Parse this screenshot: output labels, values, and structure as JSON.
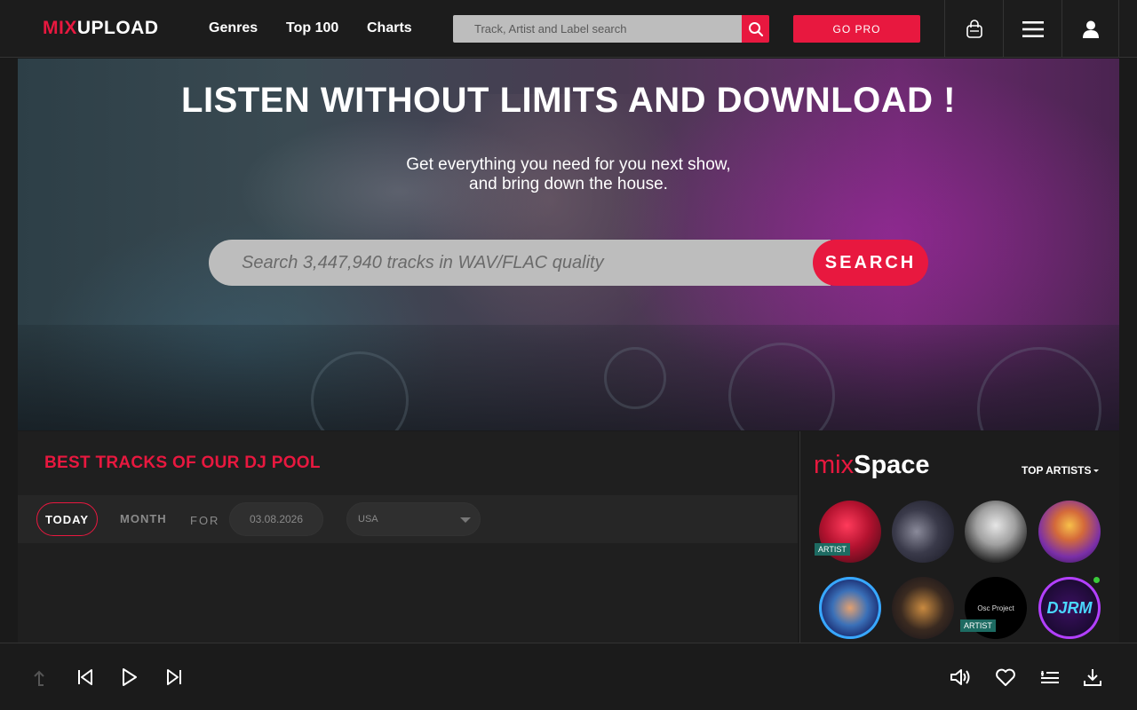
{
  "header": {
    "logo": {
      "mix": "MIX",
      "upload": "UPLOAD"
    },
    "nav": [
      {
        "label": "Genres"
      },
      {
        "label": "Top 100"
      },
      {
        "label": "Charts"
      }
    ],
    "search": {
      "placeholder": "Track, Artist and Label search"
    },
    "go_pro_label": "GO PRO",
    "icons": [
      "bag-icon",
      "menu-icon",
      "user-icon"
    ]
  },
  "hero": {
    "title": "LISTEN WITHOUT LIMITS AND DOWNLOAD !",
    "subtitle_line1": "Get everything you need for you next show,",
    "subtitle_line2": "and bring down the house.",
    "search_placeholder": "Search 3,447,940 tracks in WAV/FLAC quality",
    "search_button": "SEARCH"
  },
  "tracks": {
    "title": "BEST TRACKS OF OUR DJ POOL",
    "filters": {
      "today": "TODAY",
      "month": "MONTH",
      "for": "FOR",
      "date": "03.08.2026",
      "country": "USA"
    }
  },
  "mixspace": {
    "title_mix": "mix",
    "title_space": "Space",
    "top_artists_label": "TOP ARTISTS",
    "artists": [
      {
        "badge": "ARTIST",
        "overlay_text": ""
      },
      {
        "badge": "",
        "overlay_text": ""
      },
      {
        "badge": "",
        "overlay_text": ""
      },
      {
        "badge": "",
        "overlay_text": ""
      },
      {
        "badge": "",
        "overlay_text": ""
      },
      {
        "badge": "",
        "overlay_text": ""
      },
      {
        "badge": "ARTIST",
        "overlay_text": "Osc Project"
      },
      {
        "badge": "",
        "overlay_text": "DJRM"
      }
    ]
  },
  "colors": {
    "accent": "#e8183f",
    "badge": "#1d6b62",
    "online": "#3acb3a"
  }
}
